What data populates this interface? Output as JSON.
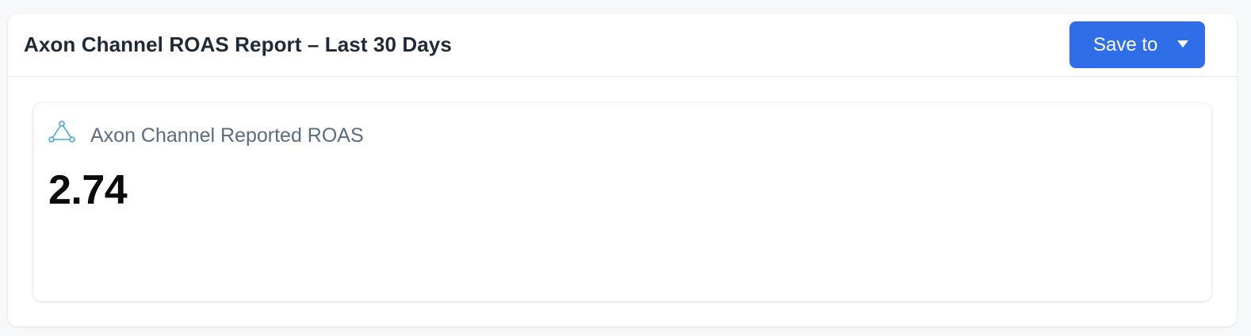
{
  "header": {
    "title": "Axon Channel ROAS Report – Last 30 Days",
    "save_button": {
      "label": "Save to",
      "icon": "caret-down-icon",
      "color": "#2f6ee8"
    }
  },
  "metric": {
    "icon": "network-triangle-icon",
    "icon_color": "#48a9d8",
    "label": "Axon Channel Reported ROAS",
    "value": "2.74"
  }
}
